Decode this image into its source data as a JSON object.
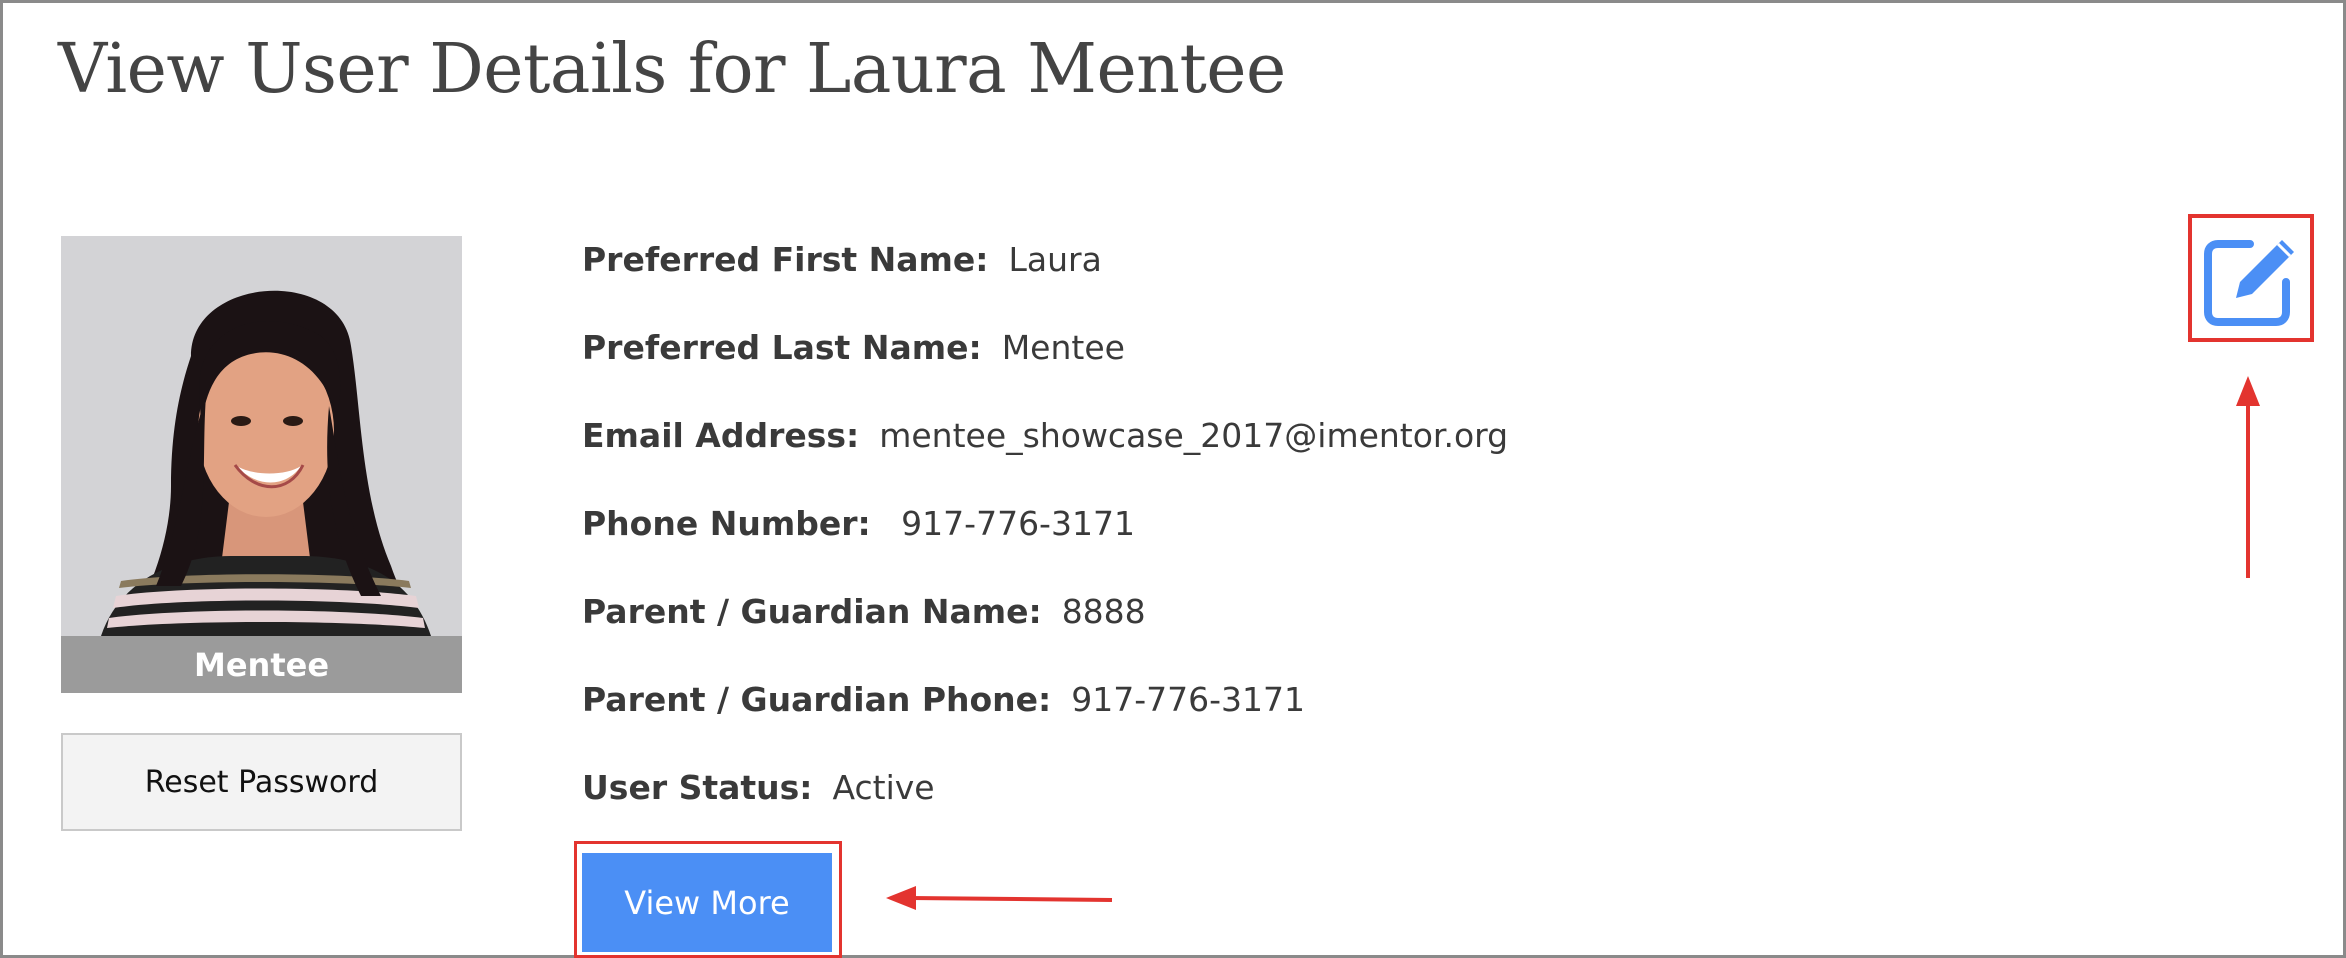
{
  "page": {
    "title": "View User Details for Laura Mentee"
  },
  "profile": {
    "role_label": "Mentee",
    "reset_password_label": "Reset Password"
  },
  "details": [
    {
      "label": "Preferred First Name:",
      "value": "Laura"
    },
    {
      "label": "Preferred Last Name:",
      "value": "Mentee"
    },
    {
      "label": "Email Address:",
      "value": "mentee_showcase_2017@imentor.org"
    },
    {
      "label": "Phone Number:",
      "value": " 917-776-3171"
    },
    {
      "label": "Parent / Guardian Name:",
      "value": "8888"
    },
    {
      "label": "Parent / Guardian Phone:",
      "value": "917-776-3171"
    },
    {
      "label": "User Status:",
      "value": "Active"
    }
  ],
  "actions": {
    "view_more_label": "View More",
    "edit_icon": "edit-icon"
  },
  "colors": {
    "accent_blue": "#4b8ff5",
    "highlight_red": "#e3342f",
    "role_bar": "#9b9b9b"
  }
}
